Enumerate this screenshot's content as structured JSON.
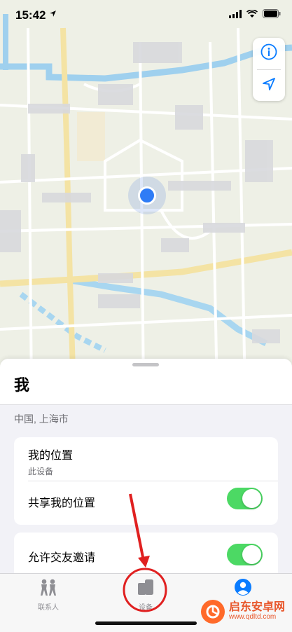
{
  "status_bar": {
    "time": "15:42",
    "location_arrow": "location-arrow-icon"
  },
  "sheet": {
    "title": "我",
    "location": "中国, 上海市",
    "my_location": {
      "title": "我的位置",
      "subtitle": "此设备"
    },
    "share_location": {
      "label": "共享我的位置",
      "enabled": true
    },
    "allow_friend_requests": {
      "label": "允许交友邀请",
      "enabled": true
    }
  },
  "tabs": [
    {
      "label": "联系人",
      "icon": "people-icon",
      "selected": false
    },
    {
      "label": "设备",
      "icon": "devices-icon",
      "selected": true
    },
    {
      "label": "",
      "icon": "person-circle-icon",
      "selected": false
    }
  ],
  "watermark": {
    "main": "启东安卓网",
    "sub": "www.qdltd.com"
  },
  "colors": {
    "accent": "#0a7cff",
    "toggle_on": "#4cd964",
    "annotation": "#e02020"
  }
}
